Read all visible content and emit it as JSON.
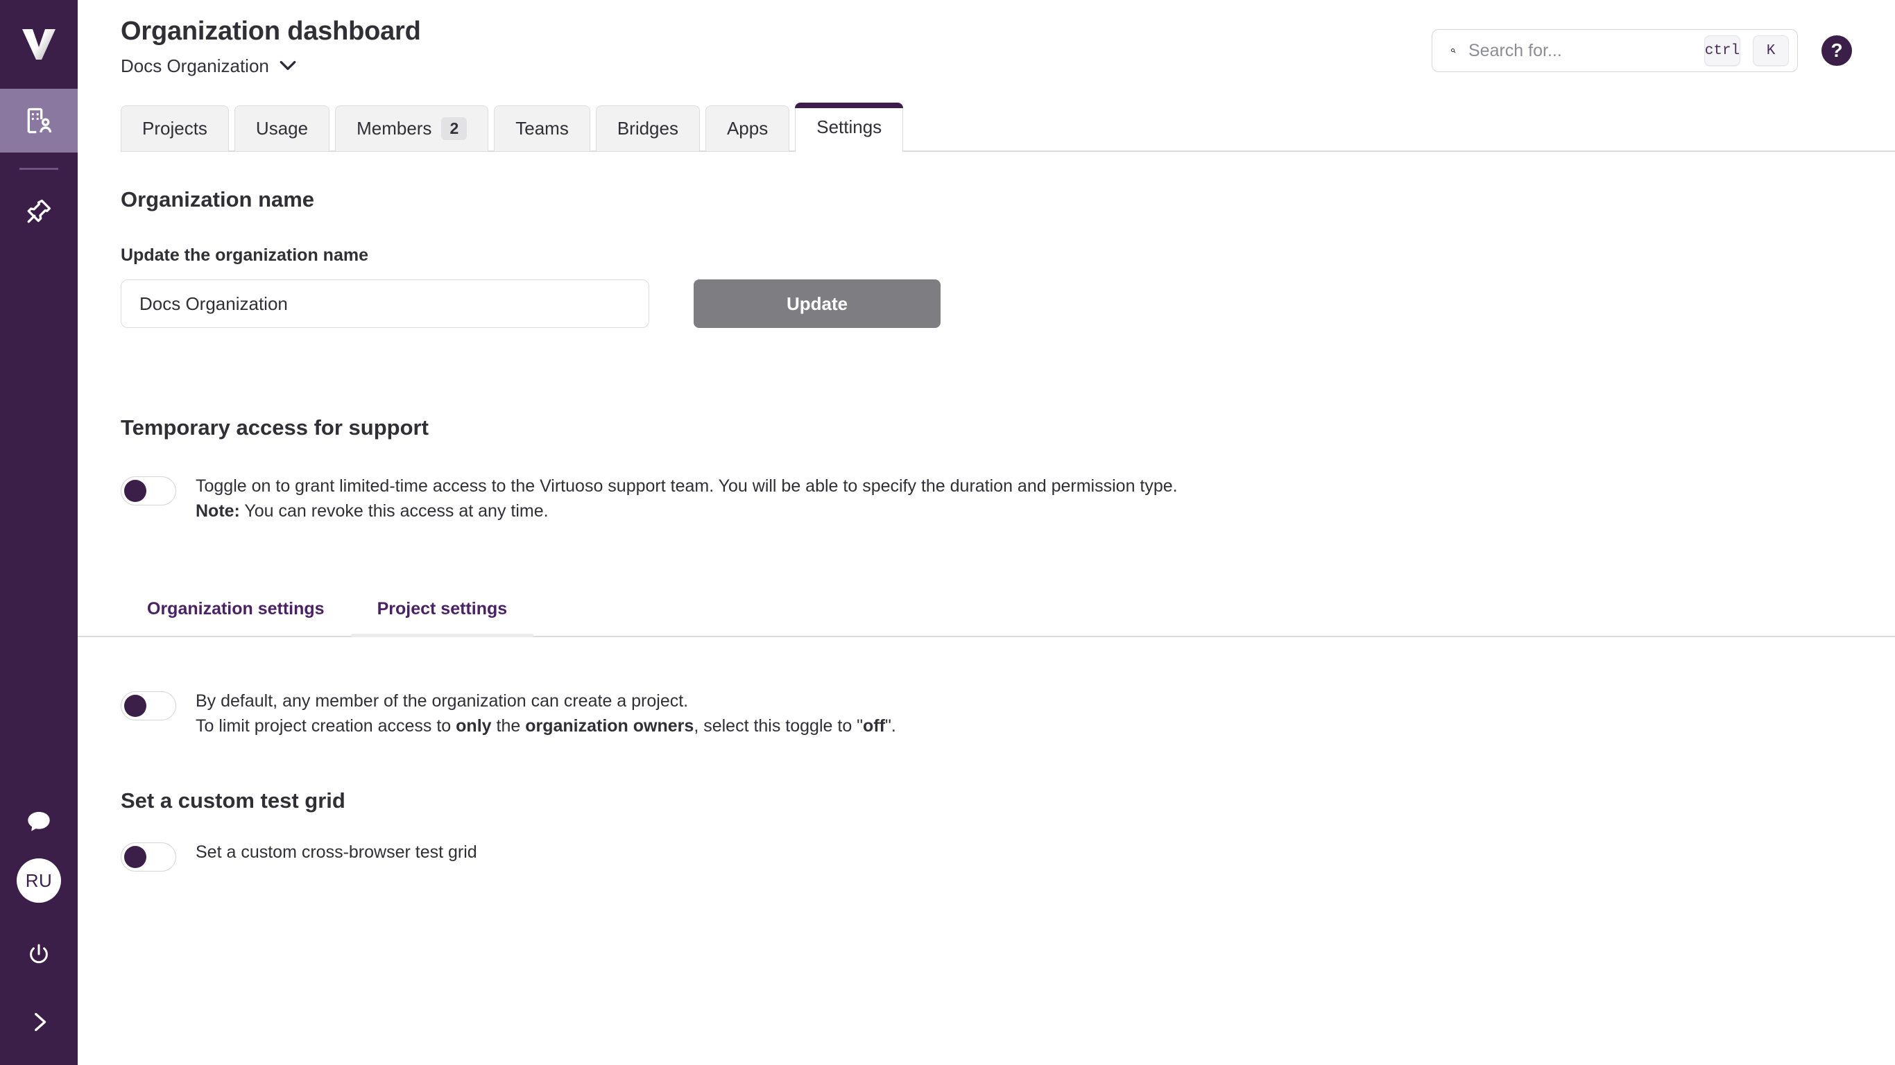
{
  "sidebar": {
    "logo": "virtuoso-v-logo",
    "items": [
      {
        "name": "organization-dashboard",
        "icon": "building-user-icon",
        "active": true
      },
      {
        "name": "pinned",
        "icon": "pushpin-icon",
        "active": false
      }
    ],
    "bottom": {
      "chat_icon": "chat-bubble-icon",
      "avatar_initials": "RU",
      "power_icon": "power-icon",
      "expand_icon": "chevron-right-icon"
    }
  },
  "header": {
    "title": "Organization dashboard",
    "org_name": "Docs Organization",
    "org_chevron_icon": "chevron-down-icon"
  },
  "search": {
    "icon": "search-icon",
    "placeholder": "Search for...",
    "value": "",
    "shortcut_modifier": "ctrl",
    "shortcut_key": "K"
  },
  "help": {
    "label": "?",
    "icon": "question-mark-icon"
  },
  "tabs": [
    {
      "label": "Projects",
      "count": null,
      "active": false
    },
    {
      "label": "Usage",
      "count": null,
      "active": false
    },
    {
      "label": "Members",
      "count": "2",
      "active": false
    },
    {
      "label": "Teams",
      "count": null,
      "active": false
    },
    {
      "label": "Bridges",
      "count": null,
      "active": false
    },
    {
      "label": "Apps",
      "count": null,
      "active": false
    },
    {
      "label": "Settings",
      "count": null,
      "active": true
    }
  ],
  "org_name_section": {
    "heading": "Organization name",
    "field_label": "Update the organization name",
    "input_value": "Docs Organization",
    "input_placeholder": "Organization name",
    "button_label": "Update"
  },
  "temporary_access": {
    "heading": "Temporary access for support",
    "toggle_on": false,
    "line1": "Toggle on to grant limited-time access to the Virtuoso support team. You will be able to specify the duration and permission type.",
    "note_label": "Note:",
    "note_text": " You can revoke this access at any time."
  },
  "subtabs": [
    {
      "label": "Organization settings",
      "active": false
    },
    {
      "label": "Project settings",
      "active": true
    }
  ],
  "project_creation": {
    "toggle_on": false,
    "line1": "By default, any member of the organization can create a project.",
    "line2_a": "To limit project creation access to ",
    "line2_b": "only",
    "line2_c": " the ",
    "line2_d": "organization owners",
    "line2_e": ", select this toggle to \"",
    "line2_f": "off",
    "line2_g": "\"."
  },
  "test_grid": {
    "heading": "Set a custom test grid",
    "toggle_on": false,
    "label": "Set a custom cross-browser test grid"
  },
  "colors": {
    "sidebar_bg": "#3b1f48",
    "sidebar_active": "#8a78a0",
    "accent_purple": "#4a2264",
    "tab_inactive_bg": "#f2f2f3",
    "update_button": "#7e7e82"
  }
}
